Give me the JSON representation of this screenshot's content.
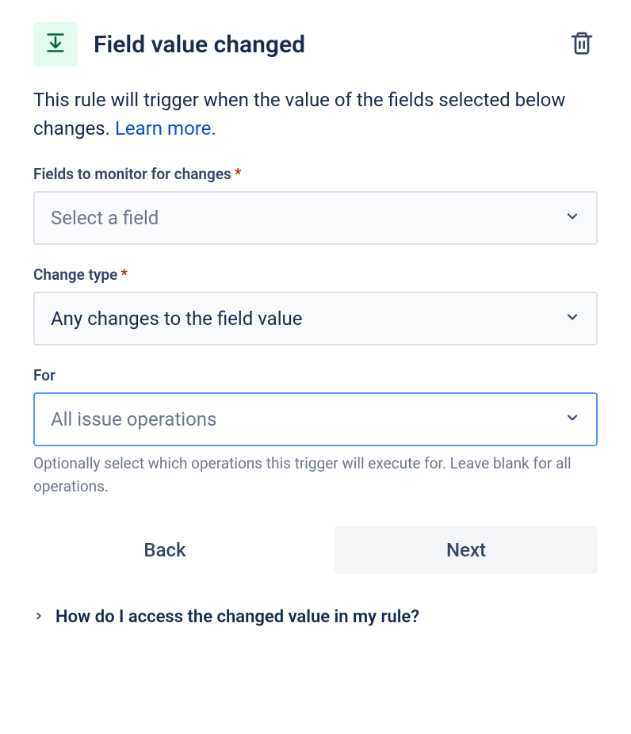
{
  "header": {
    "title": "Field value changed"
  },
  "description": {
    "text": "This rule will trigger when the value of the fields selected below changes. ",
    "link_label": "Learn more."
  },
  "fields": {
    "fields_monitor": {
      "label": "Fields to monitor for changes",
      "required": true,
      "placeholder": "Select a field"
    },
    "change_type": {
      "label": "Change type",
      "required": true,
      "value": "Any changes to the field value"
    },
    "for_ops": {
      "label": "For",
      "placeholder": "All issue operations",
      "help": "Optionally select which operations this trigger will execute for. Leave blank for all operations."
    }
  },
  "buttons": {
    "back": "Back",
    "next": "Next"
  },
  "expander": {
    "label": "How do I access the changed value in my rule?"
  }
}
